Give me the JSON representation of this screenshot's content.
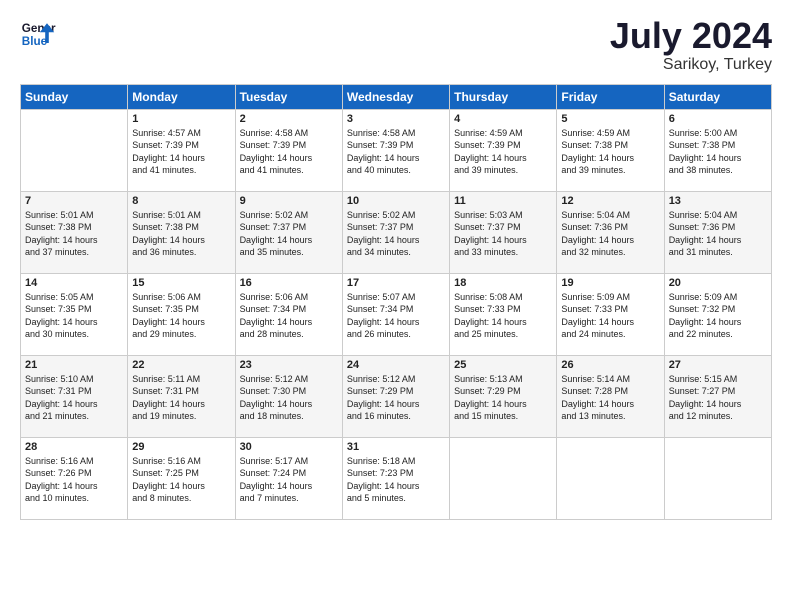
{
  "logo": {
    "line1": "General",
    "line2": "Blue"
  },
  "header": {
    "month": "July 2024",
    "location": "Sarikoy, Turkey"
  },
  "weekdays": [
    "Sunday",
    "Monday",
    "Tuesday",
    "Wednesday",
    "Thursday",
    "Friday",
    "Saturday"
  ],
  "weeks": [
    [
      {
        "day": "",
        "content": ""
      },
      {
        "day": "1",
        "content": "Sunrise: 4:57 AM\nSunset: 7:39 PM\nDaylight: 14 hours\nand 41 minutes."
      },
      {
        "day": "2",
        "content": "Sunrise: 4:58 AM\nSunset: 7:39 PM\nDaylight: 14 hours\nand 41 minutes."
      },
      {
        "day": "3",
        "content": "Sunrise: 4:58 AM\nSunset: 7:39 PM\nDaylight: 14 hours\nand 40 minutes."
      },
      {
        "day": "4",
        "content": "Sunrise: 4:59 AM\nSunset: 7:39 PM\nDaylight: 14 hours\nand 39 minutes."
      },
      {
        "day": "5",
        "content": "Sunrise: 4:59 AM\nSunset: 7:38 PM\nDaylight: 14 hours\nand 39 minutes."
      },
      {
        "day": "6",
        "content": "Sunrise: 5:00 AM\nSunset: 7:38 PM\nDaylight: 14 hours\nand 38 minutes."
      }
    ],
    [
      {
        "day": "7",
        "content": "Sunrise: 5:01 AM\nSunset: 7:38 PM\nDaylight: 14 hours\nand 37 minutes."
      },
      {
        "day": "8",
        "content": "Sunrise: 5:01 AM\nSunset: 7:38 PM\nDaylight: 14 hours\nand 36 minutes."
      },
      {
        "day": "9",
        "content": "Sunrise: 5:02 AM\nSunset: 7:37 PM\nDaylight: 14 hours\nand 35 minutes."
      },
      {
        "day": "10",
        "content": "Sunrise: 5:02 AM\nSunset: 7:37 PM\nDaylight: 14 hours\nand 34 minutes."
      },
      {
        "day": "11",
        "content": "Sunrise: 5:03 AM\nSunset: 7:37 PM\nDaylight: 14 hours\nand 33 minutes."
      },
      {
        "day": "12",
        "content": "Sunrise: 5:04 AM\nSunset: 7:36 PM\nDaylight: 14 hours\nand 32 minutes."
      },
      {
        "day": "13",
        "content": "Sunrise: 5:04 AM\nSunset: 7:36 PM\nDaylight: 14 hours\nand 31 minutes."
      }
    ],
    [
      {
        "day": "14",
        "content": "Sunrise: 5:05 AM\nSunset: 7:35 PM\nDaylight: 14 hours\nand 30 minutes."
      },
      {
        "day": "15",
        "content": "Sunrise: 5:06 AM\nSunset: 7:35 PM\nDaylight: 14 hours\nand 29 minutes."
      },
      {
        "day": "16",
        "content": "Sunrise: 5:06 AM\nSunset: 7:34 PM\nDaylight: 14 hours\nand 28 minutes."
      },
      {
        "day": "17",
        "content": "Sunrise: 5:07 AM\nSunset: 7:34 PM\nDaylight: 14 hours\nand 26 minutes."
      },
      {
        "day": "18",
        "content": "Sunrise: 5:08 AM\nSunset: 7:33 PM\nDaylight: 14 hours\nand 25 minutes."
      },
      {
        "day": "19",
        "content": "Sunrise: 5:09 AM\nSunset: 7:33 PM\nDaylight: 14 hours\nand 24 minutes."
      },
      {
        "day": "20",
        "content": "Sunrise: 5:09 AM\nSunset: 7:32 PM\nDaylight: 14 hours\nand 22 minutes."
      }
    ],
    [
      {
        "day": "21",
        "content": "Sunrise: 5:10 AM\nSunset: 7:31 PM\nDaylight: 14 hours\nand 21 minutes."
      },
      {
        "day": "22",
        "content": "Sunrise: 5:11 AM\nSunset: 7:31 PM\nDaylight: 14 hours\nand 19 minutes."
      },
      {
        "day": "23",
        "content": "Sunrise: 5:12 AM\nSunset: 7:30 PM\nDaylight: 14 hours\nand 18 minutes."
      },
      {
        "day": "24",
        "content": "Sunrise: 5:12 AM\nSunset: 7:29 PM\nDaylight: 14 hours\nand 16 minutes."
      },
      {
        "day": "25",
        "content": "Sunrise: 5:13 AM\nSunset: 7:29 PM\nDaylight: 14 hours\nand 15 minutes."
      },
      {
        "day": "26",
        "content": "Sunrise: 5:14 AM\nSunset: 7:28 PM\nDaylight: 14 hours\nand 13 minutes."
      },
      {
        "day": "27",
        "content": "Sunrise: 5:15 AM\nSunset: 7:27 PM\nDaylight: 14 hours\nand 12 minutes."
      }
    ],
    [
      {
        "day": "28",
        "content": "Sunrise: 5:16 AM\nSunset: 7:26 PM\nDaylight: 14 hours\nand 10 minutes."
      },
      {
        "day": "29",
        "content": "Sunrise: 5:16 AM\nSunset: 7:25 PM\nDaylight: 14 hours\nand 8 minutes."
      },
      {
        "day": "30",
        "content": "Sunrise: 5:17 AM\nSunset: 7:24 PM\nDaylight: 14 hours\nand 7 minutes."
      },
      {
        "day": "31",
        "content": "Sunrise: 5:18 AM\nSunset: 7:23 PM\nDaylight: 14 hours\nand 5 minutes."
      },
      {
        "day": "",
        "content": ""
      },
      {
        "day": "",
        "content": ""
      },
      {
        "day": "",
        "content": ""
      }
    ]
  ]
}
